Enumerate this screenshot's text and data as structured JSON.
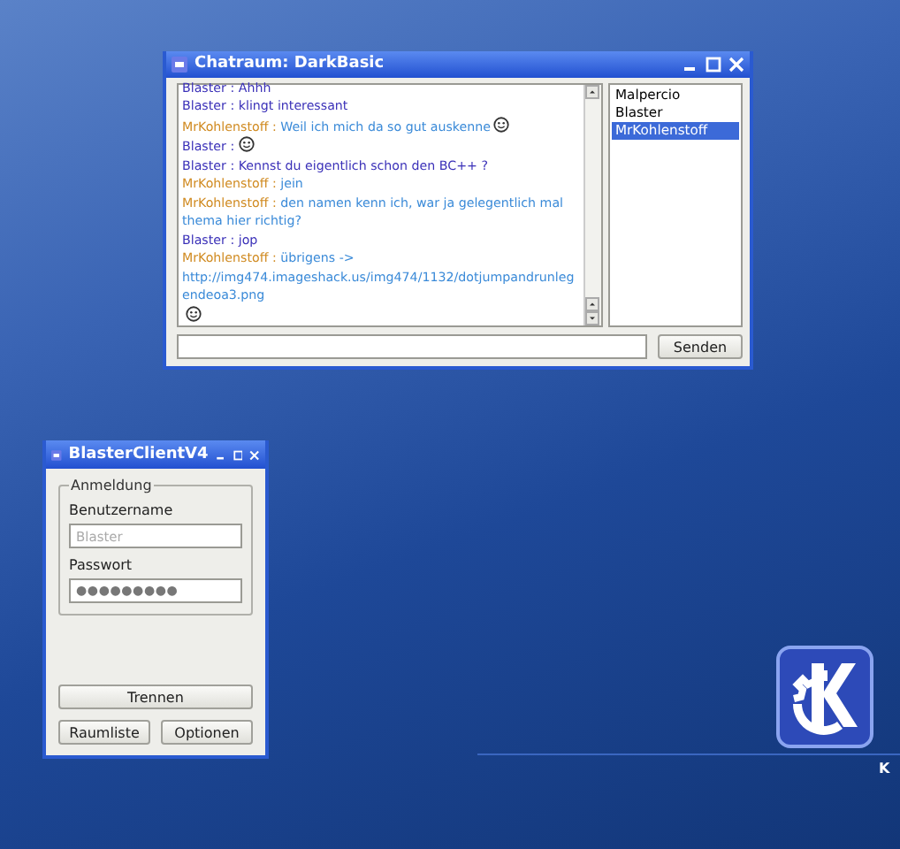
{
  "chat_window": {
    "title": "Chatraum: DarkBasic",
    "messages": [
      {
        "kind": "local",
        "sender": "Blaster :",
        "text": "Ahhh",
        "smiley": false
      },
      {
        "kind": "local",
        "sender": "Blaster :",
        "text": "klingt interessant",
        "smiley": false
      },
      {
        "kind": "remote",
        "sender": "MrKohlenstoff :",
        "text": "Weil ich mich da so gut auskenne",
        "smiley": true
      },
      {
        "kind": "local",
        "sender": "Blaster :",
        "smiley": true
      },
      {
        "kind": "local",
        "sender": "Blaster :",
        "text": "Kennst du eigentlich schon den BC++ ?",
        "smiley": false
      },
      {
        "kind": "remote",
        "sender": "MrKohlenstoff :",
        "text": "jein",
        "smiley": false
      },
      {
        "kind": "remote",
        "sender": "MrKohlenstoff :",
        "text": "den namen kenn ich, war ja gelegentlich mal thema hier richtig?",
        "smiley": false
      },
      {
        "kind": "local",
        "sender": "Blaster :",
        "text": "jop",
        "smiley": false
      },
      {
        "kind": "remote",
        "sender": "MrKohlenstoff :",
        "text": "übrigens ->",
        "link": "http://img474.imageshack.us/img474/1132/dotjumpandrunlegendeoa3.png",
        "smiley": true
      }
    ],
    "users": [
      {
        "name": "Malpercio",
        "selected": false
      },
      {
        "name": "Blaster",
        "selected": false
      },
      {
        "name": "MrKohlenstoff",
        "selected": true
      }
    ],
    "send_button": "Senden"
  },
  "login_window": {
    "title": "BlasterClientV4",
    "group": "Anmeldung",
    "username_label": "Benutzername",
    "username": "Blaster",
    "username_disabled": true,
    "password_label": "Passwort",
    "password": "●●●●●●●●●",
    "buttons": [
      "Trennen",
      "Raumliste",
      "Optionen"
    ]
  },
  "desktop": {
    "logo_caption": "K"
  }
}
